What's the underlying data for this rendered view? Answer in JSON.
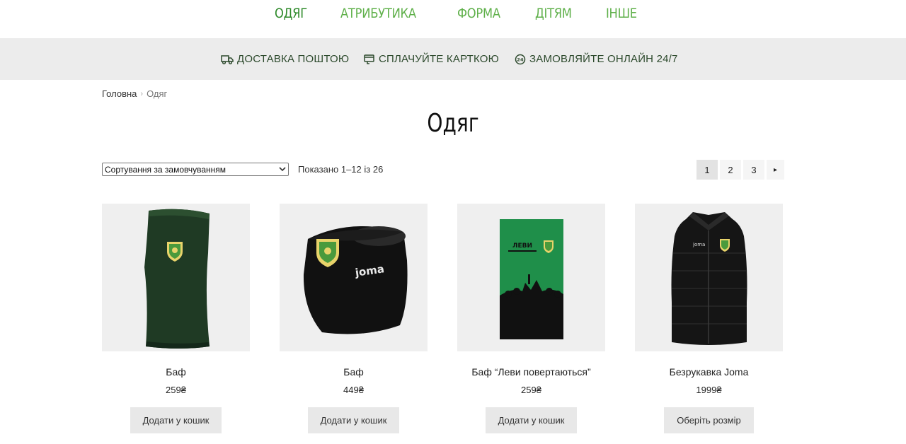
{
  "nav": {
    "items": [
      {
        "label": "ОДЯГ",
        "active": true
      },
      {
        "label": "АТРИБУТИКА",
        "active": false
      },
      {
        "label": "ФОРМА",
        "active": false
      },
      {
        "label": "ДІТЯМ",
        "active": false
      },
      {
        "label": "ІНШЕ",
        "active": false
      }
    ],
    "color": "#5fb04a",
    "active_color": "#2e8a2a"
  },
  "infobar": {
    "delivery": {
      "label": "ДОСТАВКА ПОШТОЮ",
      "icon": "delivery-truck-icon"
    },
    "payment": {
      "label": "СПЛАЧУЙТЕ КАРТКОЮ",
      "icon": "card-payment-icon"
    },
    "online": {
      "label": "ЗАМОВЛЯЙТЕ ОНЛАЙН 24/7",
      "icon": "clock-24-icon"
    }
  },
  "breadcrumb": {
    "home": "Головна",
    "separator": "›",
    "current": "Одяг"
  },
  "page_title": "Одяг",
  "toolbar": {
    "sort_value": "Сортування за замовчуванням",
    "result_count": "Показано 1–12 із 26"
  },
  "pagination": {
    "pages": [
      "1",
      "2",
      "3"
    ],
    "current": "1",
    "next": "▸"
  },
  "products": [
    {
      "name": "Баф",
      "price": "259₴",
      "button": "Додати у кошик",
      "image": "green-buff-image"
    },
    {
      "name": "Баф",
      "price": "449₴",
      "button": "Додати у кошик",
      "image": "black-snood-image"
    },
    {
      "name": "Баф “Леви повертаються”",
      "price": "259₴",
      "button": "Додати у кошик",
      "image": "green-fans-buff-image"
    },
    {
      "name": "Безрукавка Joma",
      "price": "1999₴",
      "button": "Оберіть розмір",
      "image": "black-vest-image"
    }
  ]
}
